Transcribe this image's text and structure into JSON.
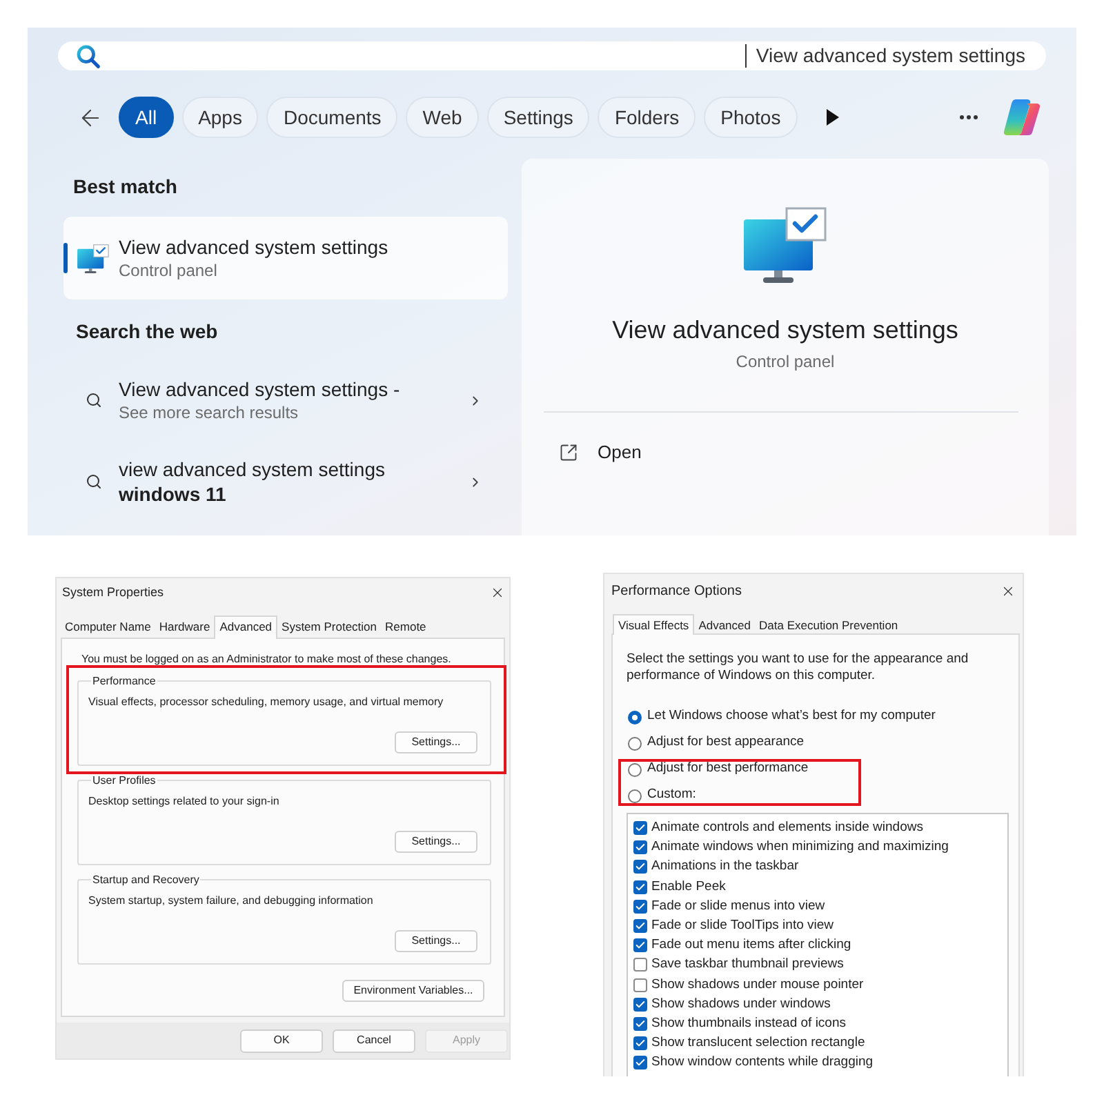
{
  "search_panel": {
    "search_field": {
      "value": "View advanced system settings"
    },
    "filters": [
      {
        "label": "All",
        "selected": true
      },
      {
        "label": "Apps",
        "selected": false
      },
      {
        "label": "Documents",
        "selected": false
      },
      {
        "label": "Web",
        "selected": false
      },
      {
        "label": "Settings",
        "selected": false
      },
      {
        "label": "Folders",
        "selected": false
      },
      {
        "label": "Photos",
        "selected": false
      }
    ],
    "best_match": {
      "heading": "Best match",
      "items": [
        {
          "title": "View advanced system settings",
          "subtitle": "Control panel",
          "selected": true
        }
      ]
    },
    "web_results": {
      "heading": "Search the web",
      "items": [
        {
          "title": "View advanced system settings -",
          "subtitle": "See more search results"
        },
        {
          "title": "view advanced system settings **windows 11**"
        }
      ]
    },
    "preview": {
      "title": "View advanced system settings",
      "subtitle": "Control panel",
      "actions": [
        {
          "label": "Open"
        }
      ]
    }
  },
  "system_properties": {
    "title": "System Properties",
    "tabs": [
      {
        "label": "Computer Name",
        "selected": false
      },
      {
        "label": "Hardware",
        "selected": false
      },
      {
        "label": "Advanced",
        "selected": true
      },
      {
        "label": "System Protection",
        "selected": false
      },
      {
        "label": "Remote",
        "selected": false
      }
    ],
    "notice": "You must be logged on as an Administrator to make most of these changes.",
    "groups": [
      {
        "label": "Performance",
        "description": "Visual effects, processor scheduling, memory usage, and virtual memory",
        "button": "Settings...",
        "highlighted": true
      },
      {
        "label": "User Profiles",
        "description": "Desktop settings related to your sign-in",
        "button": "Settings...",
        "highlighted": false
      },
      {
        "label": "Startup and Recovery",
        "description": "System startup, system failure, and debugging information",
        "button": "Settings...",
        "highlighted": false
      }
    ],
    "extra_button": "Environment Variables...",
    "buttons": [
      {
        "label": "OK",
        "disabled": false
      },
      {
        "label": "Cancel",
        "disabled": false
      },
      {
        "label": "Apply",
        "disabled": true
      }
    ]
  },
  "performance_options": {
    "title": "Performance Options",
    "tabs": [
      {
        "label": "Visual Effects",
        "selected": true
      },
      {
        "label": "Advanced",
        "selected": false
      },
      {
        "label": "Data Execution Prevention",
        "selected": false
      }
    ],
    "intro": "Select the settings you want to use for the appearance and performance of Windows on this computer.",
    "options": [
      {
        "label": "Let Windows choose what’s best for my computer",
        "selected": true,
        "highlighted": false
      },
      {
        "label": "Adjust for best appearance",
        "selected": false,
        "highlighted": false
      },
      {
        "label": "Adjust for best performance",
        "selected": false,
        "highlighted": true
      },
      {
        "label": "Custom:",
        "selected": false,
        "highlighted": true
      }
    ],
    "effects": [
      {
        "label": "Animate controls and elements inside windows",
        "checked": true
      },
      {
        "label": "Animate windows when minimizing and maximizing",
        "checked": true
      },
      {
        "label": "Animations in the taskbar",
        "checked": true
      },
      {
        "label": "Enable Peek",
        "checked": true
      },
      {
        "label": "Fade or slide menus into view",
        "checked": true
      },
      {
        "label": "Fade or slide ToolTips into view",
        "checked": true
      },
      {
        "label": "Fade out menu items after clicking",
        "checked": true
      },
      {
        "label": "Save taskbar thumbnail previews",
        "checked": false
      },
      {
        "label": "Show shadows under mouse pointer",
        "checked": false
      },
      {
        "label": "Show shadows under windows",
        "checked": true
      },
      {
        "label": "Show thumbnails instead of icons",
        "checked": true
      },
      {
        "label": "Show translucent selection rectangle",
        "checked": true
      },
      {
        "label": "Show window contents while dragging",
        "checked": true
      }
    ]
  }
}
